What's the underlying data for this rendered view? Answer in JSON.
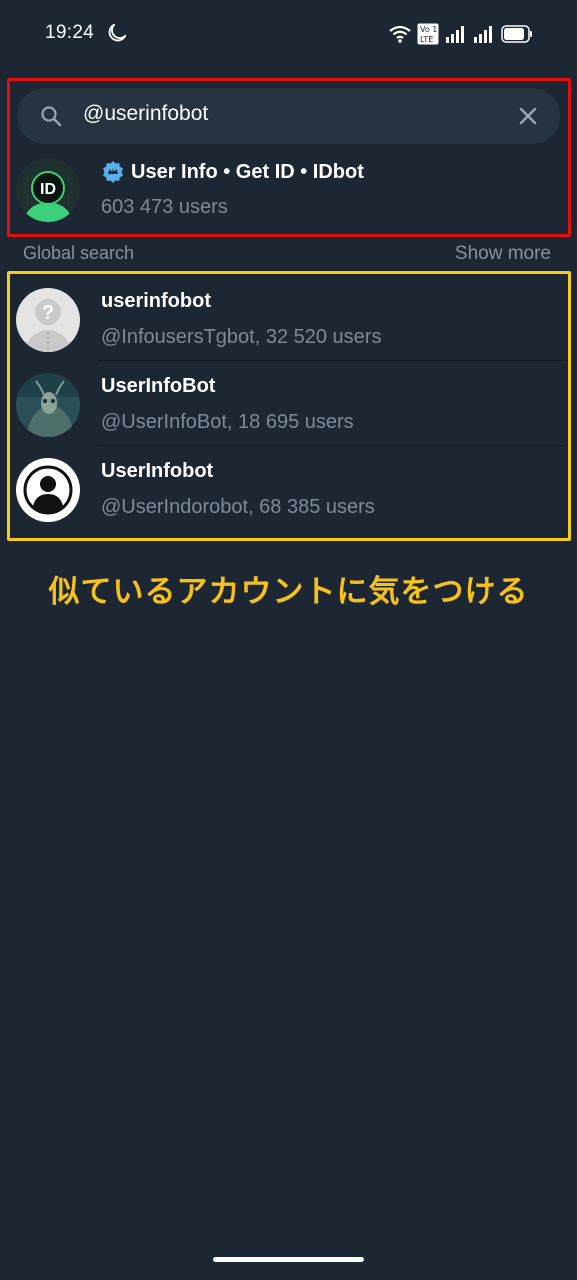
{
  "status_bar": {
    "time": "19:24",
    "icons": [
      "moon-icon",
      "wifi-icon",
      "volte-icon",
      "signal-icon",
      "signal-icon",
      "battery-icon"
    ]
  },
  "search": {
    "query": "@userinfobot",
    "icons": {
      "search": "search-icon",
      "clear": "close-icon"
    }
  },
  "top_result": {
    "title": "User Info • Get ID • IDbot",
    "subtitle": "603 473 users",
    "badge_icon": "verified-icon",
    "avatar_icon": "id-logo-icon"
  },
  "global_search": {
    "title": "Global search",
    "show_more": "Show more",
    "items": [
      {
        "title": "userinfobot",
        "subtitle": "@InfousersTgbot, 32 520 users",
        "avatar_icon": "question-avatar-icon"
      },
      {
        "title": "UserInfoBot",
        "subtitle": "@UserInfoBot, 18 695 users",
        "avatar_icon": "photo-avatar"
      },
      {
        "title": "UserInfobot",
        "subtitle": "@UserIndorobot, 68 385 users",
        "avatar_icon": "person-avatar-icon"
      }
    ]
  },
  "annotation": {
    "caption": "似ているアカウントに気をつける",
    "colors": {
      "red_box": "#e10e0e",
      "yellow_box": "#f5cd14",
      "caption": "#f6c21a"
    }
  },
  "theme": {
    "background": "#1d2733",
    "search_bg": "#263340",
    "secondary_text": "#7d8b99"
  }
}
